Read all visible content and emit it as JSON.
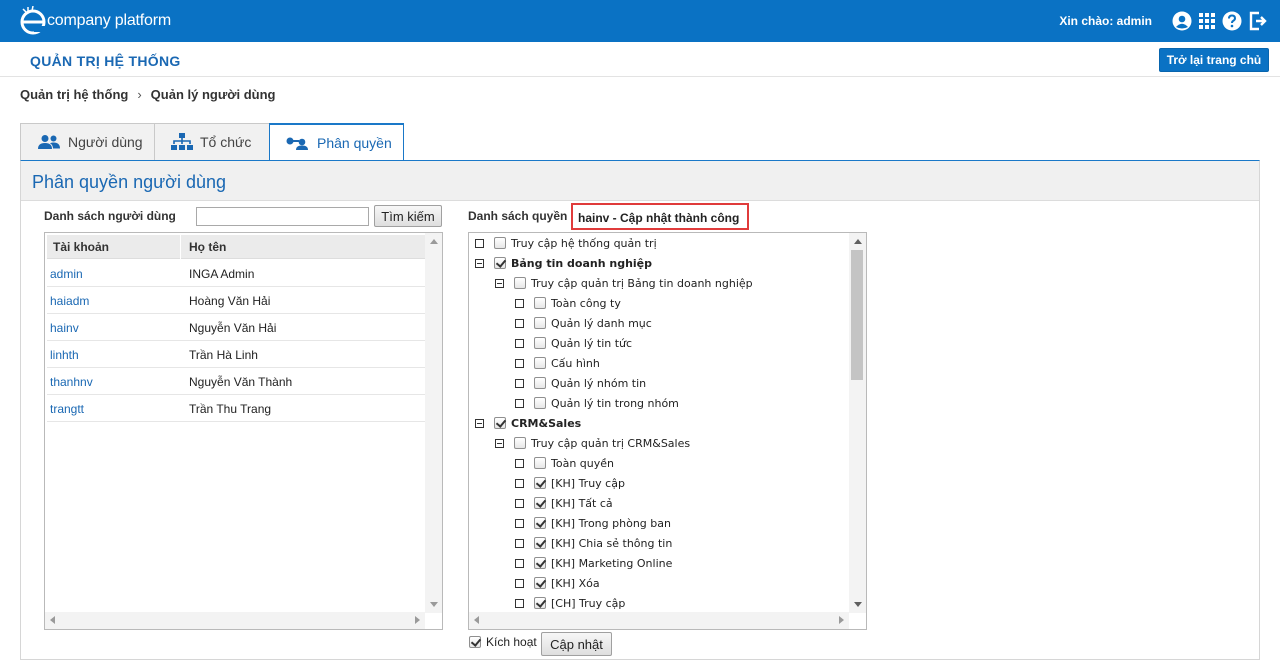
{
  "brand": {
    "logo_text": "company platform"
  },
  "topbar": {
    "greeting": "Xin chào: admin",
    "icons": [
      "user-circle-icon",
      "apps-grid-icon",
      "help-icon",
      "logout-icon"
    ]
  },
  "header": {
    "title": "QUẢN TRỊ HỆ THỐNG",
    "back_label": "Trở lại trang chủ"
  },
  "breadcrumb": {
    "items": [
      "Quản trị hệ thống",
      "Quản lý người dùng"
    ],
    "separator": "›"
  },
  "tabs": [
    {
      "label": "Người dùng",
      "icon": "users-icon",
      "active": false
    },
    {
      "label": "Tổ chức",
      "icon": "org-chart-icon",
      "active": false
    },
    {
      "label": "Phân quyền",
      "icon": "permission-icon",
      "active": true
    }
  ],
  "panel": {
    "title": "Phân quyền người dùng"
  },
  "user_list": {
    "label": "Danh sách người dùng",
    "search_value": "",
    "search_button": "Tìm kiếm",
    "columns": [
      "Tài khoản",
      "Họ tên"
    ],
    "rows": [
      {
        "account": "admin",
        "name": "INGA Admin"
      },
      {
        "account": "haiadm",
        "name": "Hoàng Văn Hải"
      },
      {
        "account": "hainv",
        "name": "Nguyễn Văn Hải"
      },
      {
        "account": "linhth",
        "name": "Trần Hà Linh"
      },
      {
        "account": "thanhnv",
        "name": "Nguyễn Văn Thành"
      },
      {
        "account": "trangtt",
        "name": "Trần Thu Trang"
      }
    ]
  },
  "permissions": {
    "label": "Danh sách quyền",
    "notice": "hainv - Cập nhật thành công",
    "tree": [
      {
        "label": "Truy cập hệ thống quản trị",
        "checked": false,
        "bold": false,
        "expander": "leaf"
      },
      {
        "label": "Bảng tin doanh nghiệp",
        "checked": true,
        "bold": true,
        "expander": "minus"
      },
      {
        "label": "Truy cập quản trị Bảng tin doanh nghiệp",
        "checked": false,
        "bold": false,
        "expander": "minus"
      },
      {
        "label": "Toàn công ty",
        "checked": false,
        "bold": false,
        "expander": "leaf"
      },
      {
        "label": "Quản lý danh mục",
        "checked": false,
        "bold": false,
        "expander": "leaf"
      },
      {
        "label": "Quản lý tin tức",
        "checked": false,
        "bold": false,
        "expander": "leaf"
      },
      {
        "label": "Cấu hình",
        "checked": false,
        "bold": false,
        "expander": "leaf"
      },
      {
        "label": "Quản lý nhóm tin",
        "checked": false,
        "bold": false,
        "expander": "leaf"
      },
      {
        "label": "Quản lý tin trong nhóm",
        "checked": false,
        "bold": false,
        "expander": "leaf"
      },
      {
        "label": "CRM&Sales",
        "checked": true,
        "bold": true,
        "expander": "minus"
      },
      {
        "label": "Truy cập quản trị CRM&Sales",
        "checked": false,
        "bold": false,
        "expander": "minus"
      },
      {
        "label": "Toàn quyền",
        "checked": false,
        "bold": false,
        "expander": "leaf"
      },
      {
        "label": "[KH] Truy cập",
        "checked": true,
        "bold": false,
        "expander": "leaf"
      },
      {
        "label": "[KH] Tất cả",
        "checked": true,
        "bold": false,
        "expander": "leaf"
      },
      {
        "label": "[KH] Trong phòng ban",
        "checked": true,
        "bold": false,
        "expander": "leaf"
      },
      {
        "label": "[KH] Chia sẻ thông tin",
        "checked": true,
        "bold": false,
        "expander": "leaf"
      },
      {
        "label": "[KH] Marketing Online",
        "checked": true,
        "bold": false,
        "expander": "leaf"
      },
      {
        "label": "[KH] Xóa",
        "checked": true,
        "bold": false,
        "expander": "leaf"
      },
      {
        "label": "[CH] Truy cập",
        "checked": true,
        "bold": false,
        "expander": "leaf"
      }
    ],
    "activate_label": "Kích hoạt",
    "activate_checked": true,
    "update_button": "Cập nhật"
  },
  "colors": {
    "brand": "#0a72c4",
    "accent": "#1a68b3",
    "notice_border": "#e03b3b"
  }
}
